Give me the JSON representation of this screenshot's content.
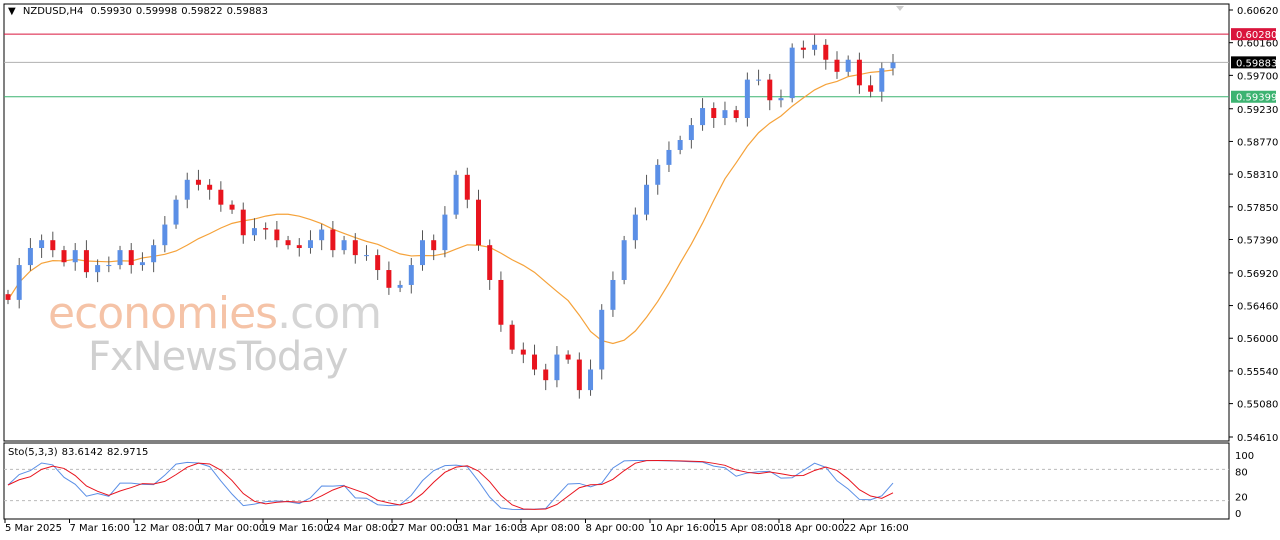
{
  "header": {
    "symbol": "NZDUSD,H4",
    "open": "0.59930",
    "high": "0.59998",
    "low": "0.59822",
    "close": "0.59883"
  },
  "watermark": {
    "brand1": "economies",
    "brand1_suffix": ".com",
    "brand2": "FxNewsToday"
  },
  "stochastic": {
    "label": "Sto(5,3,3)",
    "main": "83.6142",
    "signal": "82.9715",
    "levels": [
      "100",
      "80",
      "20",
      "0"
    ]
  },
  "colors": {
    "bull": "#5b8fe6",
    "bear": "#e8141e",
    "ma": "#f5a23a",
    "resistance": "#d9143c",
    "current": "#000000",
    "support": "#3cb371",
    "stoch_main": "#5b8fe6",
    "stoch_signal": "#e8141e"
  },
  "chart_data": {
    "type": "candlestick",
    "title": "NZDUSD,H4",
    "ylim": [
      0.5461,
      0.6062
    ],
    "y_ticks": [
      "0.60620",
      "0.60160",
      "0.59700",
      "0.59230",
      "0.58770",
      "0.58310",
      "0.57850",
      "0.57390",
      "0.56920",
      "0.56460",
      "0.56000",
      "0.55540",
      "0.55080",
      "0.54610"
    ],
    "x_ticks": [
      "5 Mar 2025",
      "7 Mar 16:00",
      "12 Mar 08:00",
      "17 Mar 00:00",
      "19 Mar 16:00",
      "24 Mar 08:00",
      "27 Mar 00:00",
      "31 Mar 16:00",
      "3 Apr 08:00",
      "8 Apr 00:00",
      "10 Apr 16:00",
      "15 Apr 08:00",
      "18 Apr 00:00",
      "22 Apr 16:00"
    ],
    "price_lines": [
      {
        "label": "0.60280",
        "value": 0.6028,
        "kind": "resistance"
      },
      {
        "label": "0.59883",
        "value": 0.59883,
        "kind": "current"
      },
      {
        "label": "0.59399",
        "value": 0.59399,
        "kind": "support"
      }
    ],
    "closes": [
      0.5654,
      0.5703,
      0.5727,
      0.5738,
      0.5724,
      0.5707,
      0.5724,
      0.5693,
      0.5703,
      0.5703,
      0.5724,
      0.5703,
      0.5707,
      0.5731,
      0.576,
      0.5795,
      0.5823,
      0.5816,
      0.5809,
      0.5788,
      0.5781,
      0.5745,
      0.5755,
      0.5753,
      0.5738,
      0.5731,
      0.5727,
      0.5738,
      0.5753,
      0.5724,
      0.5738,
      0.5717,
      0.5717,
      0.5696,
      0.5671,
      0.5675,
      0.5703,
      0.5738,
      0.5724,
      0.5774,
      0.583,
      0.5795,
      0.5731,
      0.5682,
      0.5619,
      0.5584,
      0.5577,
      0.5556,
      0.5541,
      0.5577,
      0.557,
      0.5527,
      0.5556,
      0.564,
      0.5682,
      0.5738,
      0.5774,
      0.5816,
      0.5844,
      0.5865,
      0.5879,
      0.59,
      0.5924,
      0.591,
      0.5921,
      0.591,
      0.5964,
      0.5964,
      0.5935,
      0.5938,
      0.6009,
      0.6006,
      0.6013,
      0.5992,
      0.5975,
      0.5992,
      0.5956,
      0.5947,
      0.598,
      0.5988
    ],
    "ma_period": 12
  }
}
